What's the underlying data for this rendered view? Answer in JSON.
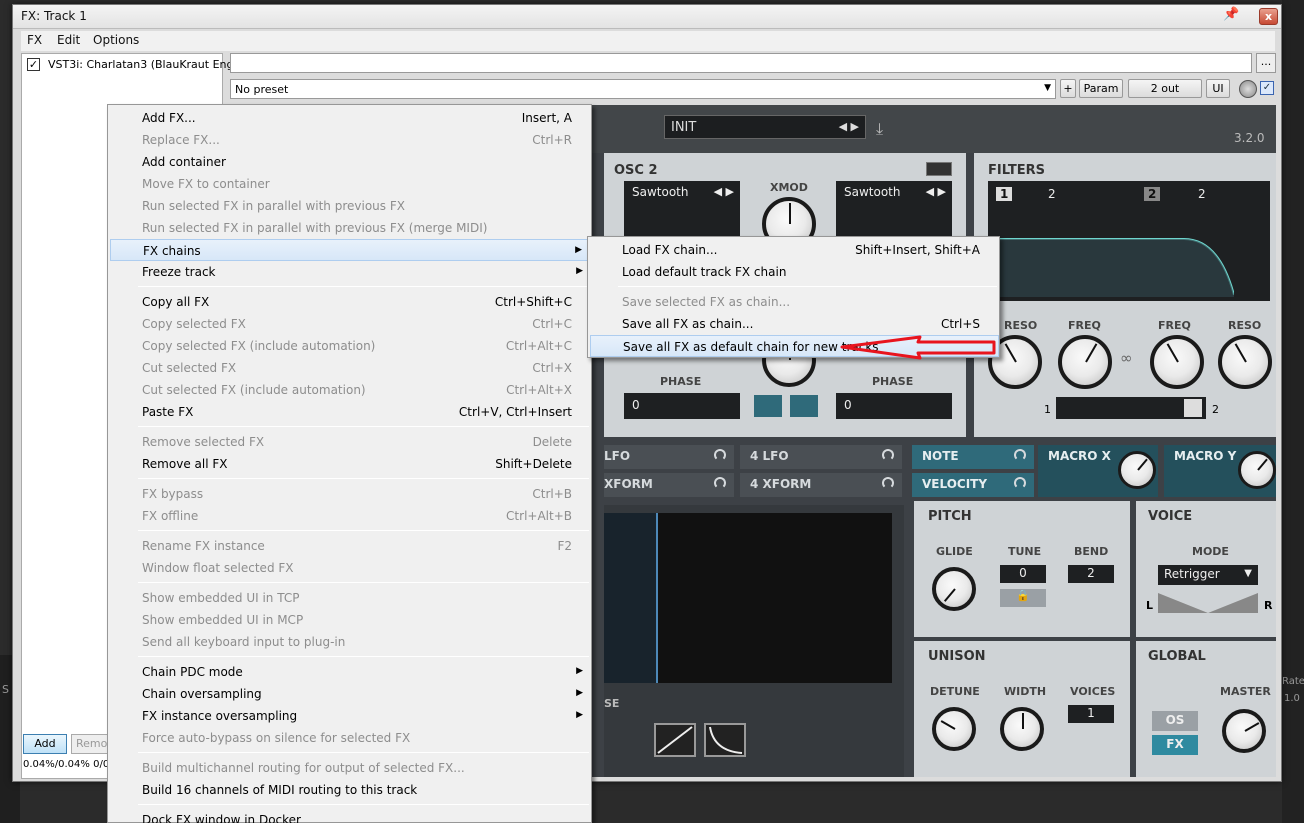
{
  "window": {
    "title": "FX: Track 1",
    "pin_icon": "pin-icon",
    "close_icon": "close-icon",
    "close_glyph": "x"
  },
  "menubar": [
    "FX",
    "Edit",
    "Options"
  ],
  "fx_list": {
    "items": [
      {
        "enabled": true,
        "name": "VST3i: Charlatan3 (BlauKraut Eng..."
      }
    ],
    "add_label": "Add",
    "remove_label": "Remov",
    "cpu": "0.04%/0.04% 0/0"
  },
  "toolbar": {
    "name_value": "",
    "dots_label": "...",
    "preset": "No preset",
    "plus_label": "+",
    "param_label": "Param",
    "out_label": "2 out",
    "ui_label": "UI",
    "enabled_check": "✓"
  },
  "plugin": {
    "preset_name": "INIT",
    "version": "3.2.0",
    "osc2": {
      "title": "OSC 2",
      "wave_left": "Sawtooth",
      "wave_right": "Sawtooth",
      "xmod_label": "XMOD",
      "phase_label_1": "PHASE",
      "phase_value_1": "0",
      "phase_label_2": "PHASE",
      "phase_value_2": "0"
    },
    "filters": {
      "title": "FILTERS",
      "slot1": "1",
      "slot1_poles": "2",
      "slot2": "2",
      "slot2_poles": "2",
      "reso_left": "RESO",
      "freq_left": "FREQ",
      "freq_right": "FREQ",
      "reso_right": "RESO",
      "balance_left": "1",
      "balance_right": "2"
    },
    "mod_row": {
      "lfo_left": "LFO",
      "lfo4": "4  LFO",
      "xform_left": "XFORM",
      "xform4": "4  XFORM",
      "note": "NOTE",
      "velocity": "VELOCITY",
      "macro_x": "MACRO X",
      "macro_y": "MACRO Y"
    },
    "pitch": {
      "title": "PITCH",
      "glide": "GLIDE",
      "tune": "TUNE",
      "tune_value": "0",
      "bend": "BEND",
      "bend_value": "2"
    },
    "voice": {
      "title": "VOICE",
      "mode_label": "MODE",
      "mode_value": "Retrigger",
      "left": "L",
      "right": "R"
    },
    "unison": {
      "title": "UNISON",
      "detune": "DETUNE",
      "width": "WIDTH",
      "voices": "VOICES",
      "voices_value": "1"
    },
    "global": {
      "title": "GLOBAL",
      "master": "MASTER",
      "os": "OS",
      "fx": "FX"
    },
    "env_label": "SE"
  },
  "context_menu": {
    "items": [
      {
        "label": "Add FX...",
        "shortcut": "Insert, A",
        "disabled": false
      },
      {
        "label": "Replace FX...",
        "shortcut": "Ctrl+R",
        "disabled": true
      },
      {
        "label": "Add container",
        "shortcut": "",
        "disabled": false
      },
      {
        "label": "Move FX to container",
        "shortcut": "",
        "disabled": true
      },
      {
        "label": "Run selected FX in parallel with previous FX",
        "shortcut": "",
        "disabled": true
      },
      {
        "label": "Run selected FX in parallel with previous FX (merge MIDI)",
        "shortcut": "",
        "disabled": true
      },
      {
        "label": "FX chains",
        "shortcut": "",
        "disabled": false,
        "submenu": true,
        "highlighted": true
      },
      {
        "label": "Freeze track",
        "shortcut": "",
        "disabled": false,
        "submenu": true
      },
      {
        "separator": true
      },
      {
        "label": "Copy all FX",
        "shortcut": "Ctrl+Shift+C",
        "disabled": false
      },
      {
        "label": "Copy selected FX",
        "shortcut": "Ctrl+C",
        "disabled": true
      },
      {
        "label": "Copy selected FX (include automation)",
        "shortcut": "Ctrl+Alt+C",
        "disabled": true
      },
      {
        "label": "Cut selected FX",
        "shortcut": "Ctrl+X",
        "disabled": true
      },
      {
        "label": "Cut selected FX (include automation)",
        "shortcut": "Ctrl+Alt+X",
        "disabled": true
      },
      {
        "label": "Paste FX",
        "shortcut": "Ctrl+V, Ctrl+Insert",
        "disabled": false
      },
      {
        "separator": true
      },
      {
        "label": "Remove selected FX",
        "shortcut": "Delete",
        "disabled": true
      },
      {
        "label": "Remove all FX",
        "shortcut": "Shift+Delete",
        "disabled": false
      },
      {
        "separator": true
      },
      {
        "label": "FX bypass",
        "shortcut": "Ctrl+B",
        "disabled": true
      },
      {
        "label": "FX offline",
        "shortcut": "Ctrl+Alt+B",
        "disabled": true
      },
      {
        "separator": true
      },
      {
        "label": "Rename FX instance",
        "shortcut": "F2",
        "disabled": true
      },
      {
        "label": "Window float selected FX",
        "shortcut": "",
        "disabled": true
      },
      {
        "separator": true
      },
      {
        "label": "Show embedded UI in TCP",
        "shortcut": "",
        "disabled": true
      },
      {
        "label": "Show embedded UI in MCP",
        "shortcut": "",
        "disabled": true
      },
      {
        "label": "Send all keyboard input to plug-in",
        "shortcut": "",
        "disabled": true
      },
      {
        "separator": true
      },
      {
        "label": "Chain PDC mode",
        "shortcut": "",
        "disabled": false,
        "submenu": true
      },
      {
        "label": "Chain oversampling",
        "shortcut": "",
        "disabled": false,
        "submenu": true
      },
      {
        "label": "FX instance oversampling",
        "shortcut": "",
        "disabled": false,
        "submenu": true
      },
      {
        "label": "Force auto-bypass on silence for selected FX",
        "shortcut": "",
        "disabled": true
      },
      {
        "separator": true
      },
      {
        "label": "Build multichannel routing for output of selected FX...",
        "shortcut": "",
        "disabled": true
      },
      {
        "label": "Build 16 channels of MIDI routing to this track",
        "shortcut": "",
        "disabled": false
      },
      {
        "separator": true
      },
      {
        "label": "Dock FX window in Docker",
        "shortcut": "",
        "disabled": false
      }
    ]
  },
  "submenu": {
    "items": [
      {
        "label": "Load FX chain...",
        "shortcut": "Shift+Insert, Shift+A",
        "disabled": false
      },
      {
        "label": "Load default track FX chain",
        "shortcut": "",
        "disabled": false
      },
      {
        "separator": true
      },
      {
        "label": "Save selected FX as chain...",
        "shortcut": "",
        "disabled": true
      },
      {
        "label": "Save all FX as chain...",
        "shortcut": "Ctrl+S",
        "disabled": false
      },
      {
        "label": "Save all FX as default chain for new tracks",
        "shortcut": "",
        "disabled": false,
        "highlighted": true
      }
    ]
  },
  "background": {
    "left_text": "S",
    "right_text_1": "Rate",
    "right_text_2": "1.0"
  },
  "annotation": {
    "arrow_color": "#e8141e"
  }
}
